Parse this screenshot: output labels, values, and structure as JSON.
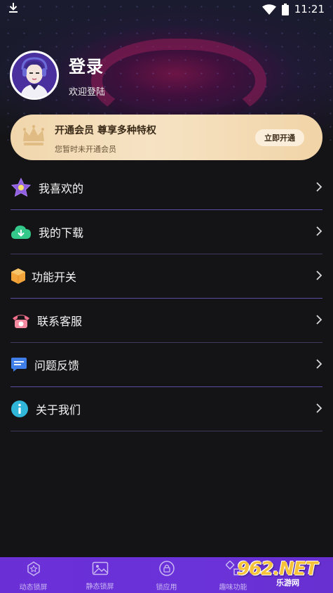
{
  "status_bar": {
    "time": "11:21",
    "icons": [
      "download-icon",
      "wifi-icon",
      "battery-icon"
    ]
  },
  "profile": {
    "title": "登录",
    "subtitle": "欢迎登陆"
  },
  "vip": {
    "title": "开通会员  尊享多种特权",
    "subtitle": "您暂时未开通会员",
    "button": "立即开通",
    "icon": "crown-icon"
  },
  "menu": {
    "items": [
      {
        "label": "我喜欢的",
        "icon": "star-icon"
      },
      {
        "label": "我的下载",
        "icon": "cloud-download-icon"
      },
      {
        "label": "功能开关",
        "icon": "box-icon"
      },
      {
        "label": "联系客服",
        "icon": "telephone-icon"
      },
      {
        "label": "问题反馈",
        "icon": "message-icon"
      },
      {
        "label": "关于我们",
        "icon": "info-icon"
      }
    ]
  },
  "bottom_nav": {
    "items": [
      {
        "label": "动态锁屏",
        "icon": "dynamic-lock-icon"
      },
      {
        "label": "静态锁屏",
        "icon": "image-icon"
      },
      {
        "label": "锁应用",
        "icon": "lock-icon"
      },
      {
        "label": "趣味功能",
        "icon": "fun-icon"
      }
    ]
  },
  "watermark": {
    "main": "962.NET",
    "sub": "乐游网"
  },
  "colors": {
    "background": "#141416",
    "vip_gold": "#f1d6ac",
    "nav_purple": "#6b2fd6",
    "divider": "#5a4ea3"
  }
}
